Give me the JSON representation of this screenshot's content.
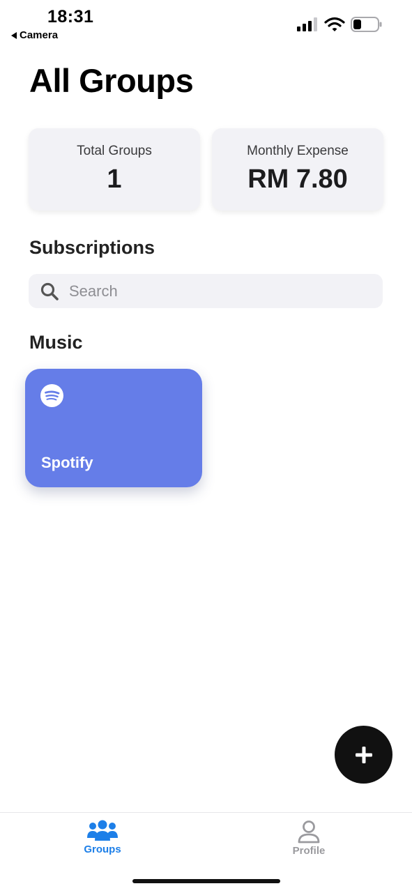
{
  "status_bar": {
    "time": "18:31",
    "back_label": "Camera",
    "icons": [
      "signal-icon",
      "wifi-icon",
      "battery-icon"
    ]
  },
  "header": {
    "title": "All Groups"
  },
  "stats": {
    "total_groups_label": "Total Groups",
    "total_groups_value": "1",
    "monthly_expense_label": "Monthly Expense",
    "monthly_expense_value": "RM 7.80"
  },
  "subscriptions": {
    "title": "Subscriptions",
    "search_placeholder": "Search",
    "search_value": ""
  },
  "categories": [
    {
      "name": "Music",
      "groups": [
        {
          "name": "Spotify",
          "icon": "spotify-icon",
          "color": "#657de8"
        }
      ]
    }
  ],
  "fab": {
    "icon": "plus-icon"
  },
  "tab_bar": {
    "items": [
      {
        "label": "Groups",
        "icon": "groups-icon",
        "active": true,
        "color": "#1d7fe8"
      },
      {
        "label": "Profile",
        "icon": "profile-icon",
        "active": false,
        "color": "#9a9a9e"
      }
    ]
  }
}
